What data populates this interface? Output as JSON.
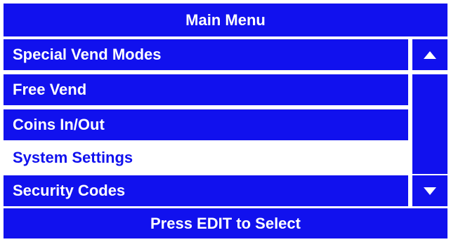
{
  "header": {
    "title": "Main Menu"
  },
  "menu": {
    "items": [
      {
        "label": "Special Vend Modes",
        "selected": false
      },
      {
        "label": "Free Vend",
        "selected": false
      },
      {
        "label": "Coins In/Out",
        "selected": false
      },
      {
        "label": "System Settings",
        "selected": true
      },
      {
        "label": "Security Codes",
        "selected": false
      }
    ]
  },
  "scrollbar": {
    "up_icon": "triangle-up-icon",
    "down_icon": "triangle-down-icon"
  },
  "footer": {
    "instruction": "Press EDIT to Select"
  },
  "colors": {
    "background": "#ffffff",
    "panel_blue": "#1111ee",
    "text_on_blue": "#ffffff",
    "selected_text": "#1111ee"
  }
}
